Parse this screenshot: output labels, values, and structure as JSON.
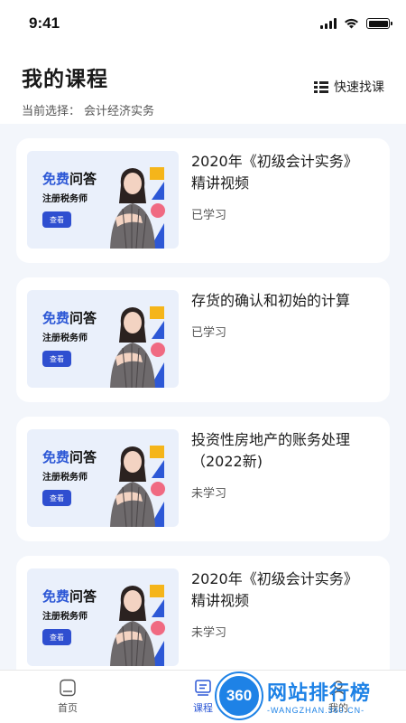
{
  "status_bar": {
    "time": "9:41"
  },
  "header": {
    "title": "我的课程",
    "current_prefix": "当前选择：",
    "current_value": "会计经济实务",
    "quick_find_label": "快速找课"
  },
  "thumbnail": {
    "title_highlight": "免费",
    "title_rest": "问答",
    "subtitle": "注册税务师",
    "button_label": "查看"
  },
  "courses": [
    {
      "title": "2020年《初级会计实务》精讲视频",
      "status": "已学习"
    },
    {
      "title": "存货的确认和初始的计算",
      "status": "已学习"
    },
    {
      "title": "投资性房地产的账务处理（2022新)",
      "status": "未学习"
    },
    {
      "title": "2020年《初级会计实务》精讲视频",
      "status": "未学习"
    }
  ],
  "bottom_nav": {
    "items": [
      {
        "label": "首页",
        "icon": "home-icon"
      },
      {
        "label": "课程",
        "icon": "course-icon"
      },
      {
        "label": "我的",
        "icon": "profile-icon"
      }
    ],
    "active_index": 1
  },
  "watermark": {
    "badge": "360",
    "name": "网站排行榜",
    "url": "-WANGZHAN.360.CN-"
  },
  "colors": {
    "accent": "#2d58d6",
    "background": "#f3f6fb",
    "watermark": "#1e82e6"
  }
}
